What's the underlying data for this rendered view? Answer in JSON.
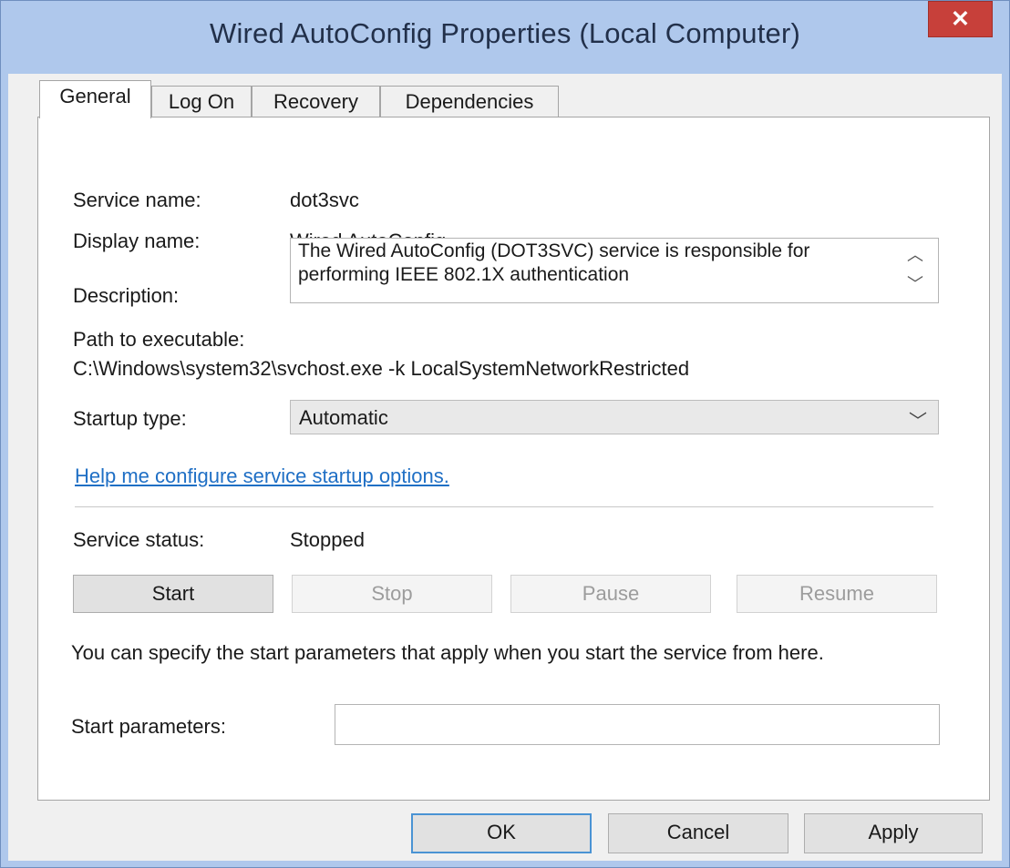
{
  "window": {
    "title": "Wired AutoConfig Properties (Local Computer)",
    "close_glyph": "✕"
  },
  "tabs": [
    {
      "label": "General",
      "active": true
    },
    {
      "label": "Log On",
      "active": false
    },
    {
      "label": "Recovery",
      "active": false
    },
    {
      "label": "Dependencies",
      "active": false
    }
  ],
  "general": {
    "service_name_label": "Service name:",
    "service_name_value": "dot3svc",
    "display_name_label": "Display name:",
    "display_name_value": "Wired AutoConfig",
    "description_label": "Description:",
    "description_value": "The Wired AutoConfig (DOT3SVC) service is responsible for performing IEEE 802.1X authentication",
    "description_scroll_up_glyph": "︿",
    "description_scroll_down_glyph": "﹀",
    "path_label": "Path to executable:",
    "path_value": "C:\\Windows\\system32\\svchost.exe -k LocalSystemNetworkRestricted",
    "startup_type_label": "Startup type:",
    "startup_type_value": "Automatic",
    "startup_type_arrow_glyph": "﹀",
    "help_link": "Help me configure service startup options.",
    "service_status_label": "Service status:",
    "service_status_value": "Stopped",
    "buttons": {
      "start": "Start",
      "stop": "Stop",
      "pause": "Pause",
      "resume": "Resume"
    },
    "start_params_hint": "You can specify the start parameters that apply when you start the service from here.",
    "start_params_label": "Start parameters:",
    "start_params_value": ""
  },
  "footer": {
    "ok": "OK",
    "cancel": "Cancel",
    "apply": "Apply"
  },
  "colors": {
    "title_bar": "#afc8ec",
    "close_button": "#c7403a",
    "link": "#1f6fc5",
    "default_button_border": "#4a93d4"
  }
}
